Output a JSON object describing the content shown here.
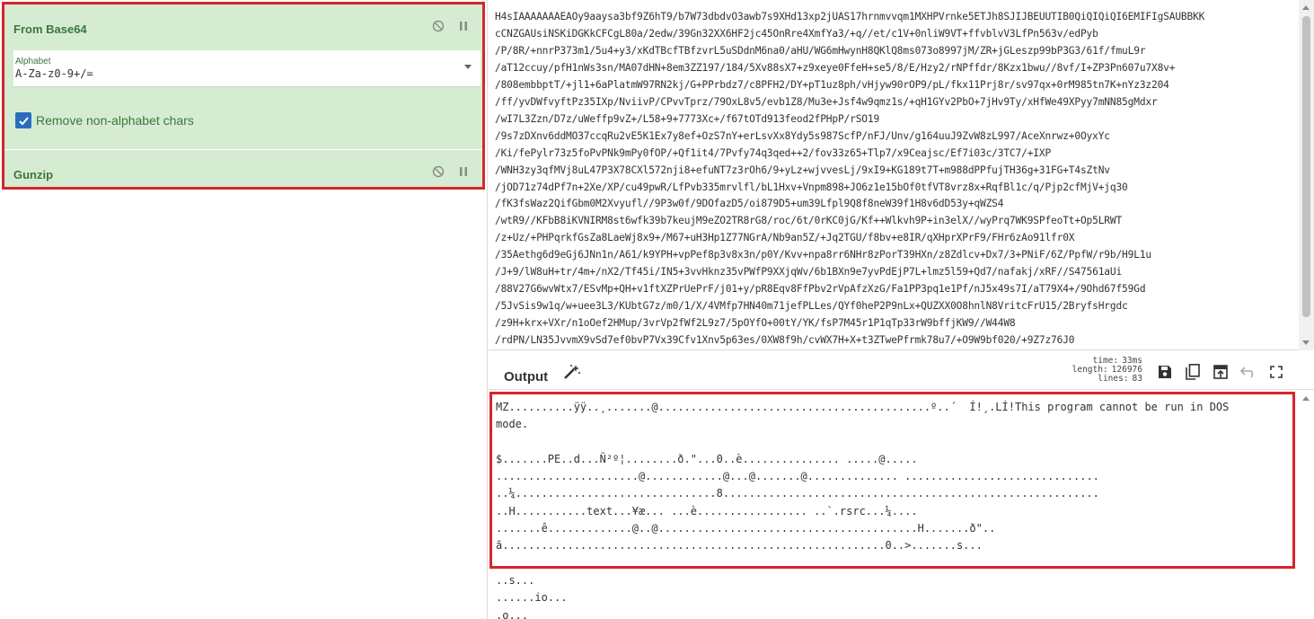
{
  "recipe": {
    "operations": [
      {
        "title": "From Base64",
        "alphabet_label": "Alphabet",
        "alphabet_value": "A-Za-z0-9+/=",
        "remove_nonalpha_label": "Remove non-alphabet chars",
        "remove_nonalpha_checked": true
      },
      {
        "title": "Gunzip"
      }
    ]
  },
  "input": {
    "lines": [
      "H4sIAAAAAAAEAOy9aaysa3bf9Z6hT9/b7W73dbdvO3awb7s9XHd13xp2jUAS17hrnmvvqm1MXHPVrnke5ETJh8SJIJBEUUTIB0QiQIQiQI6EMIFIgSAUBBKK",
      "cCNZGAUsiNSKiDGKkCFCgL80a/2edw/39Gn32XX6HF2jc45OnRre4XmfYa3/+q//et/c1V+0nliW9VT+ffvblvV3LfPn563v/edPyb",
      "/P/8R/+nnrP373m1/5u4+y3/xKdTBcfTBfzvrL5uSDdnM6na0/aHU/WG6mHwynH8QKlQ8ms073o8997jM/ZR+jGLeszp99bP3G3/61f/fmuL9r",
      "/aT12ccuy/pfH1nWs3sn/MA07dHN+8em3ZZ197/184/5Xv88sX7+z9xeye0FfeH+se5/8/E/Hzy2/rNPffdr/8Kzx1bwu//8vf/I+ZP3Pn607u7X8v+",
      "/808embbptT/+jl1+6aPlatmW97RN2kj/G+PPrbdz7/c8PFH2/DY+pT1uz8ph/vHjyw90rOP9/pL/fkx11Prj8r/sv97qx+0rM985tn7K+nYz3z204",
      "/ff/yvDWfvyftPz35IXp/NviivP/CPvvTprz/79OxL8v5/evb1Z8/Mu3e+Jsf4w9qmz1s/+qH1GYv2PbO+7jHv9Ty/xHfWe49XPyy7mNN85gMdxr",
      "/wI7L3Zzn/D7z/uWeffp9vZ+/L58+9+7773Xc+/f67tOTd913feod2fPHpP/rSO19",
      "/9s7zDXnv6ddMO37ccqRu2vE5K1Ex7y8ef+OzS7nY+erLsvXx8Ydy5s987ScfP/nFJ/Unv/g164uuJ9ZvW8zL997/AceXnrwz+0OyxYc",
      "/Ki/fePylr73z5foPvPNk9mPy0fOP/+Qf1it4/7Pvfy74q3qed++2/fov33z65+Tlp7/x9Ceajsc/Ef7i03c/3TC7/+IXP",
      "/WNH3zy3qfMVj8uL47P3X78CXl572nji8+efuNT7z3rOh6/9+yLz+wjvvesLj/9xI9+KG189t7T+m988dPPfujTH36g+31FG+T4sZtNv",
      "/jOD71z74dPf7n+2Xe/XP/cu49pwR/LfPvb335mrvlfl/bL1Hxv+Vnpm898+JO6z1e15bOf0tfVT8vrz8x+RqfBl1c/q/Pjp2cfMjV+jq30",
      "/fK3fsWaz2QifGbm0M2Xvyufl//9P3w0f/9DOfazD5/oi879D5+um39Lfpl9Q8f8neW39f1H8v6dD53y+qWZS4",
      "/wtR9//KFbB8iKVNIRM8st6wfk39b7keujM9eZO2TR8rG8/roc/6t/0rKC0jG/Kf++Wlkvh9P+in3elX//wyPrq7WK9SPfeoTt+Op5LRWT",
      "/z+Uz/+PHPqrkfGsZa8LaeWj8x9+/M67+uH3Hp1Z77NGrA/Nb9an5Z/+Jq2TGU/f8bv+e8IR/qXHprXPrF9/FHr6zAo91lfr0X",
      "/35Aethg6d9eGj6JNn1n/A61/k9YPH+vpPef8p3v8x3n/p0Y/Kvv+npa8rr6NHr8zPorT39HXn/z8Zdlcv+Dx7/3+PNiF/6Z/PpfW/r9b/H9L1u",
      "/J+9/lW8uH+tr/4m+/nX2/Tf45i/IN5+3vvHknz35vPWfP9XXjqWv/6b1BXn9e7yvPdEjP7L+lmz5l59+Qd7/nafakj/xRF//S47561aUi",
      "/88V27G6wvWtx7/ESvMp+QH+v1ftXZPrUePrF/j01+y/pR8Eqv8FfPbv2rVpAfzXzG/Fa1PP3pq1e1Pf/nJ5x49s7I/aT79X4+/9Ohd67f59Gd",
      "/5JvSis9w1q/w+uee3L3/KUbtG7z/m0/1/X/4VMfp7HN40m71jefPLLes/QYf0heP2P9nLx+QUZXX0O8hnlN8VritcFrU15/2BryfsHrgdc",
      "/z9H+krx+VXr/n1oOef2HMup/3vrVp2fWf2L9z7/5pOYfO+00tY/YK/fsP7M45r1P1qTp33rW9bffjKW9//W44W8",
      "/rdPN/LN35JvvmX9vSd7ef0bvP7Vx39Cfv1Xnv5p63es/0XW8f9h/cvWX7H+X+t3ZTwePfrmk78u7/+O9W9bf020/+9Z7z76J0"
    ]
  },
  "output": {
    "title": "Output",
    "stats": {
      "time_label": "time:",
      "time_value": "33ms",
      "length_label": "length:",
      "length_value": "126976",
      "lines_label": "lines:",
      "lines_value": "83"
    },
    "lines": [
      "MZ..........ÿÿ..¸.......@..........................................º..´  Í!¸.LÍ!This program cannot be run in DOS",
      "mode.",
      "",
      "$.......PE..d...Ñ²º¦........ð.\"...0..è............... .....@.....",
      "......................@............@...@.......@.............. ..............................",
      "..¼...............................8..........................................................",
      "..H...........text...¥æ... ...è................. ..`.rsrc...¼....",
      ".......ê.............@..@........................................H.......ð\"..",
      "ã...........................................................0..>.......s...",
      "",
      "..s...",
      "......io...",
      ".o..."
    ]
  }
}
